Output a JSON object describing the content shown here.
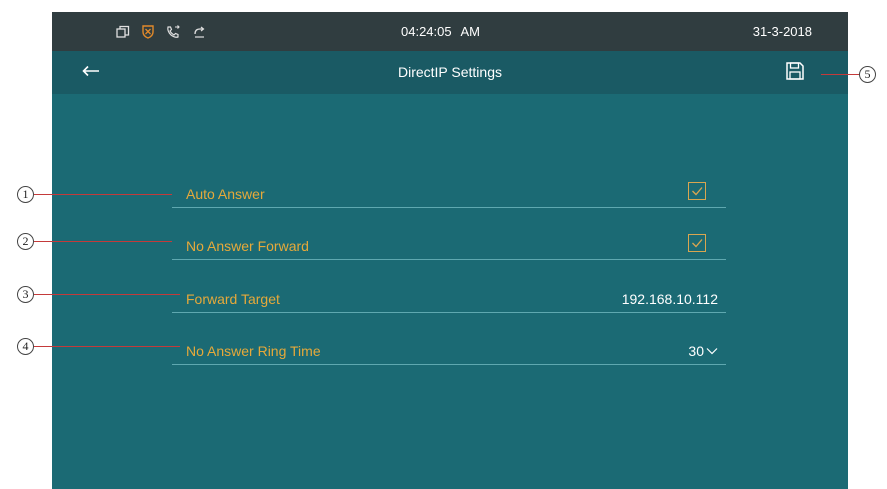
{
  "status_bar": {
    "icons": [
      "window-icon",
      "shield-icon",
      "phone-forward-icon",
      "refresh-icon"
    ],
    "time": "04:24:05 AM",
    "date": "31-3-2018"
  },
  "header": {
    "title": "DirectIP Settings",
    "back_icon": "back-arrow-icon",
    "save_icon": "save-icon"
  },
  "settings": {
    "auto_answer": {
      "label": "Auto Answer",
      "checked": true
    },
    "no_answer_forward": {
      "label": "No Answer Forward",
      "checked": true
    },
    "forward_target": {
      "label": "Forward Target",
      "value": "192.168.10.112"
    },
    "no_answer_ring_time": {
      "label": "No Answer Ring Time",
      "value": "30"
    }
  },
  "callouts": [
    "1",
    "2",
    "3",
    "4",
    "5"
  ],
  "colors": {
    "panel": "#1b6a74",
    "header": "#1a5a64",
    "status_bar": "#303d40",
    "label": "#e6a93a",
    "callout_line": "#c43a3a"
  }
}
